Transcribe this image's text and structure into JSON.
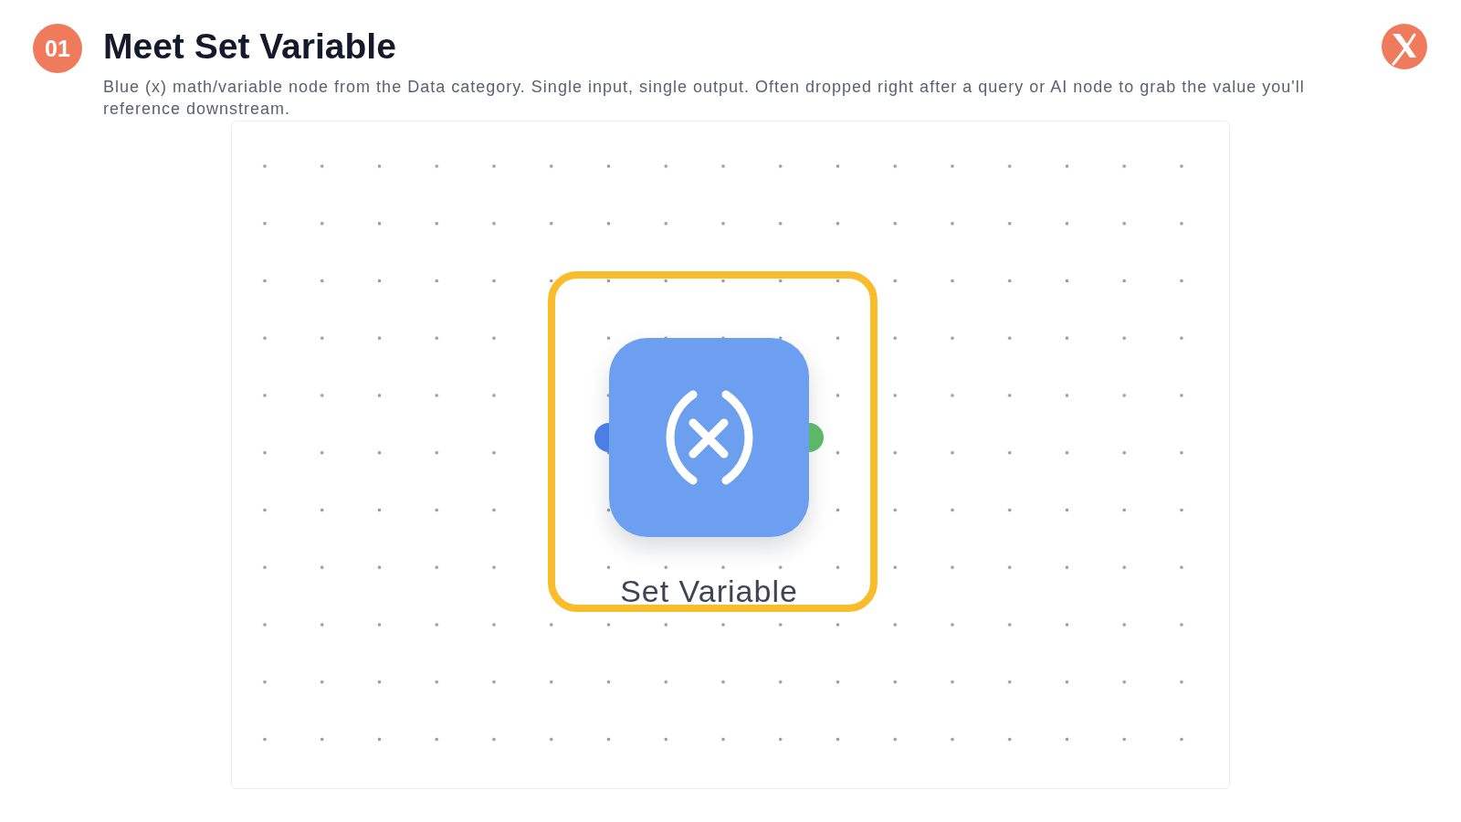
{
  "header": {
    "step_number": "01",
    "title": "Meet Set Variable",
    "description": "Blue (x) math/variable node from the Data category. Single input, single output. Often dropped right after a query or AI node to grab the value you'll reference downstream."
  },
  "canvas": {
    "node": {
      "label": "Set Variable",
      "highlighted": true,
      "ports": [
        {
          "kind": "input",
          "color": "#4b7fe6"
        },
        {
          "kind": "output",
          "color": "#5cb868"
        }
      ]
    }
  }
}
